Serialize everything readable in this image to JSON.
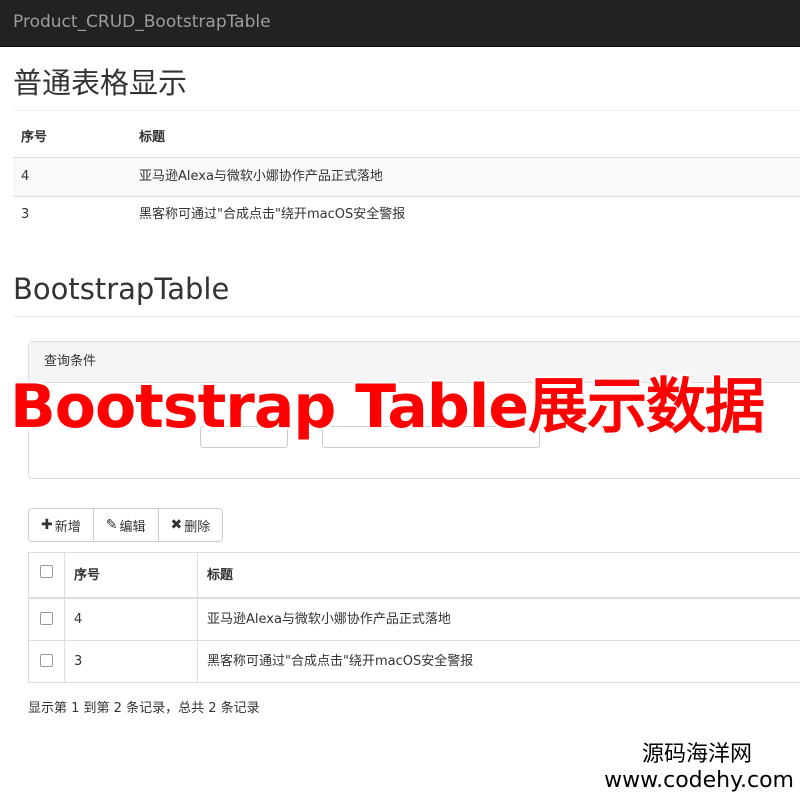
{
  "navbar": {
    "brand": "Product_CRUD_BootstrapTable"
  },
  "section_simple": {
    "title": "普通表格显示",
    "headers": {
      "id": "序号",
      "title": "标题"
    },
    "rows": [
      {
        "id": "4",
        "title": "亚马逊Alexa与微软小娜协作产品正式落地"
      },
      {
        "id": "3",
        "title": "黑客称可通过\"合成点击\"绕开macOS安全警报"
      }
    ]
  },
  "section_bt": {
    "title": "BootstrapTable",
    "query_panel": {
      "title": "查询条件"
    },
    "toolbar": {
      "add": {
        "icon": "plus-icon",
        "label": "新增"
      },
      "edit": {
        "icon": "pencil-icon",
        "label": "编辑"
      },
      "delete": {
        "icon": "remove-icon",
        "label": "删除"
      }
    },
    "headers": {
      "id": "序号",
      "title": "标题"
    },
    "rows": [
      {
        "id": "4",
        "title": "亚马逊Alexa与微软小娜协作产品正式落地",
        "checked": false
      },
      {
        "id": "3",
        "title": "黑客称可通过\"合成点击\"绕开macOS安全警报",
        "checked": false
      }
    ],
    "pagination_info": "显示第 1 到第 2 条记录，总共 2 条记录"
  },
  "overlay_banner": "Bootstrap Table展示数据",
  "watermark": {
    "line1": "源码海洋网",
    "line2": "www.codehy.com"
  },
  "colors": {
    "navbar_bg": "#222222",
    "navbar_text": "#9d9d9d",
    "overlay_text": "#ff0000",
    "stripe": "#f9f9f9",
    "border": "#dddddd"
  }
}
